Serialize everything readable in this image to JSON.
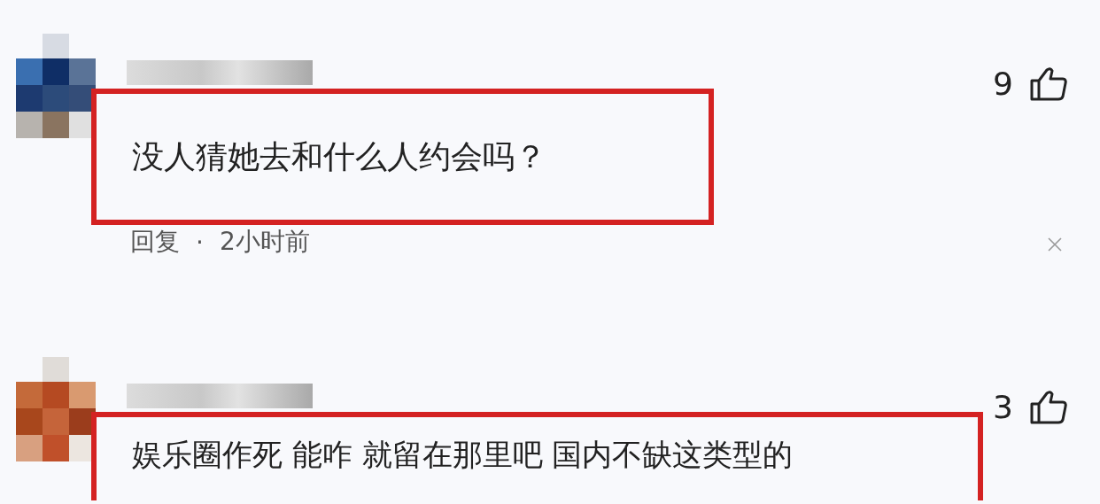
{
  "comments": [
    {
      "like_count": "9",
      "text": "没人猜她去和什么人约会吗？",
      "highlighted": true,
      "reply": "回复",
      "separator": "·",
      "time": "2小时前"
    },
    {
      "like_count": "3",
      "text": "娱乐圈作死 能咋 就留在那里吧 国内不缺这类型的",
      "highlighted": true
    }
  ]
}
